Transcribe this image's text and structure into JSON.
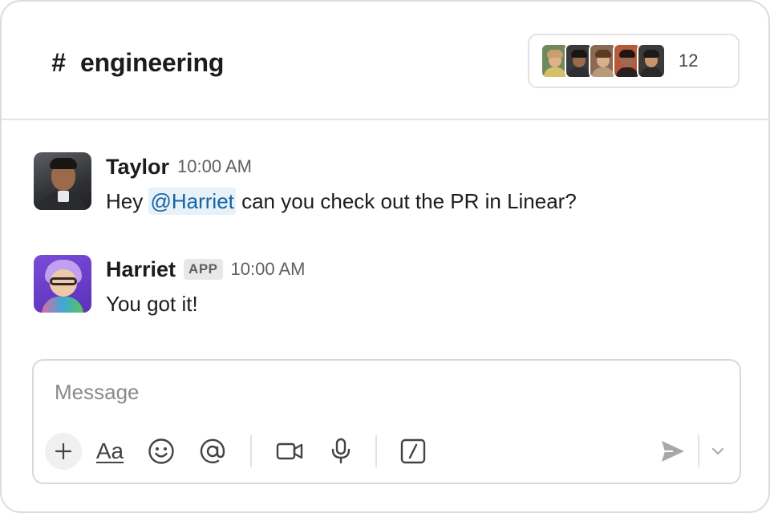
{
  "header": {
    "channel_symbol": "#",
    "channel_name": "engineering",
    "member_count": "12",
    "member_avatars": [
      {
        "name": "member-1",
        "bg": "#6e8a5c",
        "skin": "#e0b08c",
        "hair": "#c9a06a",
        "shirt": "#d4c06a"
      },
      {
        "name": "member-2",
        "bg": "#3a3a3e",
        "skin": "#9a6a4a",
        "hair": "#1a1512",
        "shirt": "#2e2f33"
      },
      {
        "name": "member-3",
        "bg": "#8a6a52",
        "skin": "#d8b08c",
        "hair": "#5a3a24",
        "shirt": "#b89a7a"
      },
      {
        "name": "member-4",
        "bg": "#b55a3a",
        "skin": "#a06a50",
        "hair": "#1e1410",
        "shirt": "#2a2020"
      },
      {
        "name": "member-5",
        "bg": "#3c3a38",
        "skin": "#c8946e",
        "hair": "#1a1a1a",
        "shirt": "#2a2a2a"
      }
    ]
  },
  "messages": [
    {
      "sender": "Taylor",
      "time": "10:00 AM",
      "text_before": "Hey ",
      "mention": "@Harriet",
      "text_after": " can you check out the PR in Linear?"
    },
    {
      "sender": "Harriet",
      "badge": "APP",
      "time": "10:00 AM",
      "text": "You got it!"
    }
  ],
  "composer": {
    "placeholder": "Message",
    "format_label": "Aa",
    "icons": [
      "plus-icon",
      "format-text-icon",
      "emoji-icon",
      "mention-icon",
      "video-icon",
      "microphone-icon",
      "slash-command-icon",
      "send-icon",
      "chevron-down-icon"
    ]
  },
  "colors": {
    "mention_text": "#1264a3",
    "mention_bg": "#e8f0f8",
    "text_primary": "#1d1c1d",
    "text_secondary": "#616061"
  }
}
